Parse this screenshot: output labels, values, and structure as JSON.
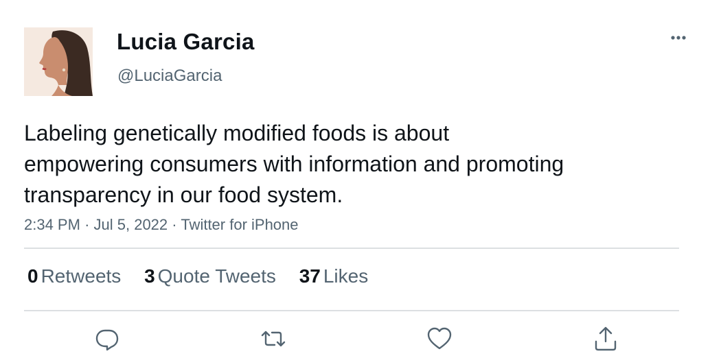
{
  "author": {
    "display_name": "Lucia Garcia",
    "handle": "@LuciaGarcia",
    "avatar_icon": "profile-photo"
  },
  "tweet": {
    "text_lines": [
      "Labeling genetically modified foods is about",
      "empowering consumers with information and promoting",
      "transparency in our food system."
    ],
    "time": "2:34 PM",
    "date": "Jul 5, 2022",
    "source": "Twitter for iPhone",
    "separator": "·"
  },
  "stats": {
    "retweets": {
      "count": "0",
      "label": "Retweets"
    },
    "quotes": {
      "count": "3",
      "label": "Quote Tweets"
    },
    "likes": {
      "count": "37",
      "label": "Likes"
    }
  },
  "icons": {
    "more": "more-horizontal-icon",
    "reply": "reply-icon",
    "retweet": "retweet-icon",
    "like": "heart-icon",
    "share": "share-icon"
  },
  "colors": {
    "text": "#0f1419",
    "secondary": "#536471",
    "divider": "#dcdfe2"
  }
}
